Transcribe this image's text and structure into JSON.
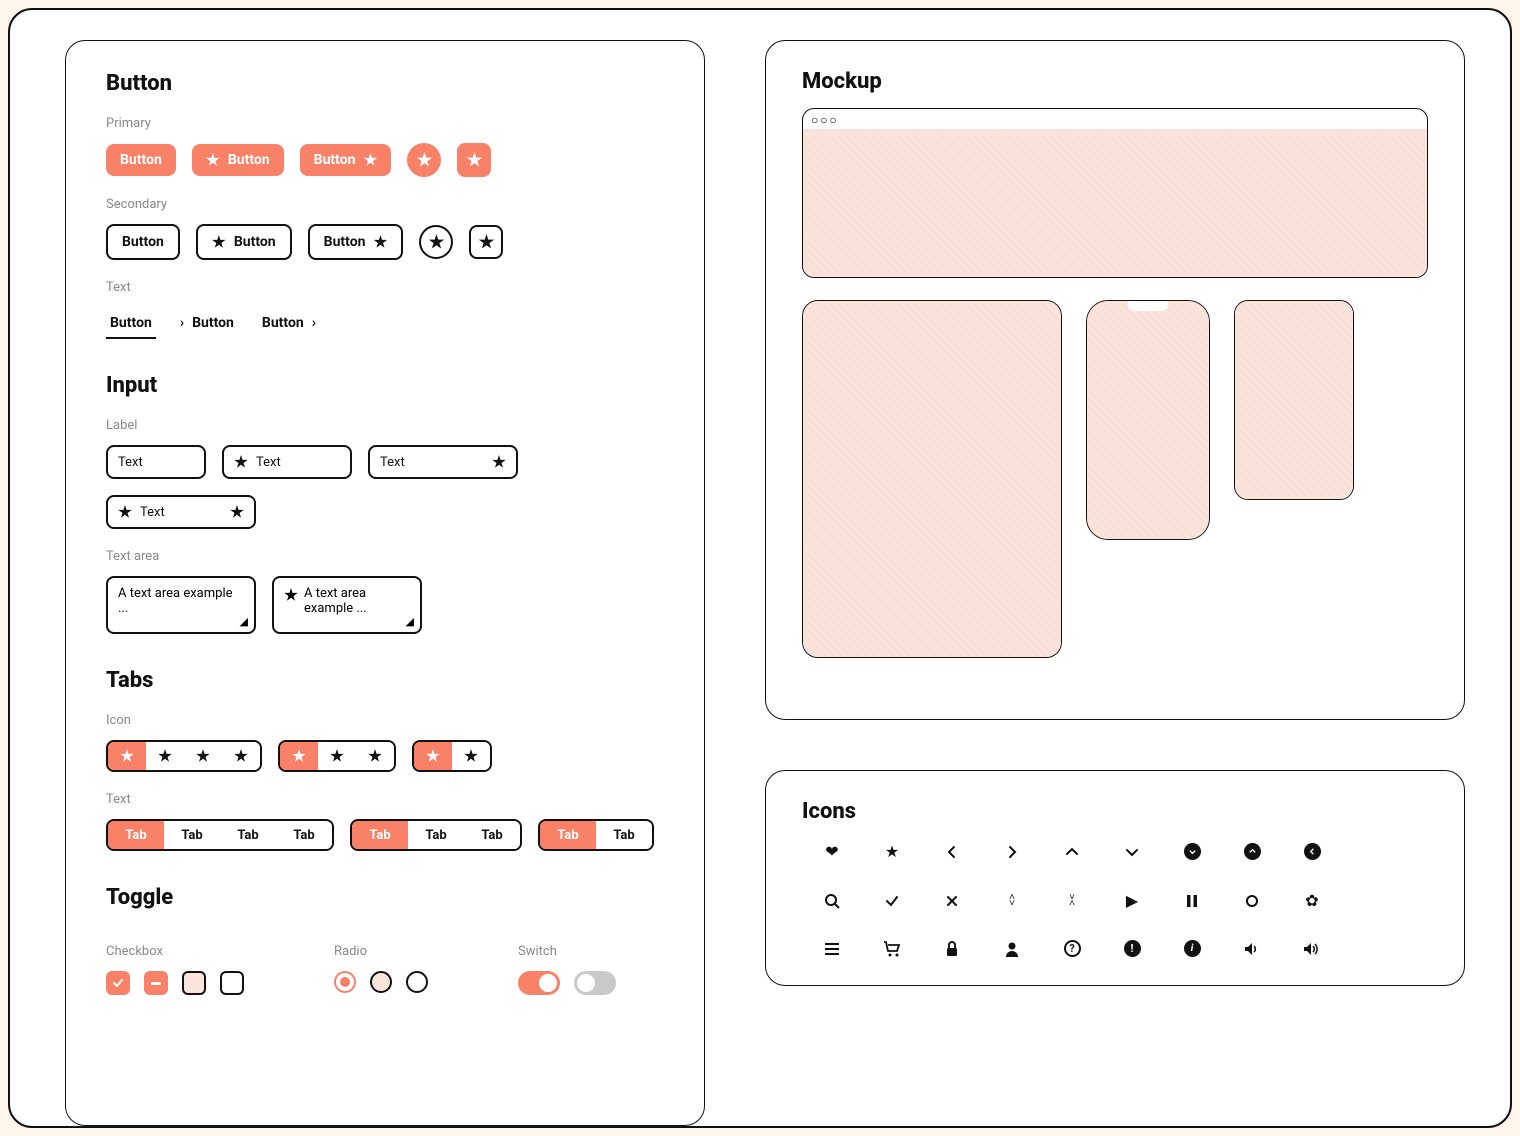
{
  "sections": {
    "button": "Button",
    "input": "Input",
    "tabs": "Tabs",
    "toggle": "Toggle",
    "mockup": "Mockup",
    "icons": "Icons"
  },
  "button": {
    "primary_label": "Primary",
    "secondary_label": "Secondary",
    "text_label": "Text",
    "cta": "Button"
  },
  "input": {
    "label": "Label",
    "textarea_label": "Text area",
    "text": "Text",
    "textarea_sample": "A text area example ..."
  },
  "tabs": {
    "icon_label": "Icon",
    "text_label": "Text",
    "tab": "Tab"
  },
  "toggle": {
    "checkbox_label": "Checkbox",
    "radio_label": "Radio",
    "switch_label": "Switch"
  },
  "icons": {
    "row1": [
      "heart",
      "star",
      "chevron-left",
      "chevron-right",
      "chevron-up",
      "chevron-down",
      "circle-down",
      "circle-up",
      "circle-left"
    ],
    "row2": [
      "search",
      "check",
      "close",
      "sort",
      "collapse",
      "play",
      "pause",
      "record",
      "gear"
    ],
    "row3": [
      "menu",
      "cart",
      "lock",
      "user",
      "help",
      "alert",
      "info",
      "volume",
      "volume-up"
    ]
  }
}
